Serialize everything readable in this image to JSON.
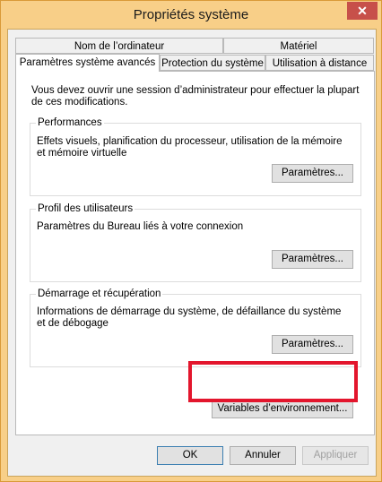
{
  "window": {
    "title": "Propriétés système",
    "close_symbol": "✕"
  },
  "tabs": {
    "row1": [
      "Nom de l’ordinateur",
      "Matériel"
    ],
    "row2": [
      "Paramètres système avancés",
      "Protection du système",
      "Utilisation à distance"
    ]
  },
  "panel": {
    "intro": "Vous devez ouvrir une session d’administrateur pour effectuer la plupart de ces modifications.",
    "performance": {
      "title": "Performances",
      "description": "Effets visuels, planification du processeur, utilisation de la mémoire et mémoire virtuelle",
      "button": "Paramètres..."
    },
    "profiles": {
      "title": "Profil des utilisateurs",
      "description": "Paramètres du Bureau liés à votre connexion",
      "button": "Paramètres..."
    },
    "startup": {
      "title": "Démarrage et récupération",
      "description": "Informations de démarrage du système, de défaillance du système et de débogage",
      "button": "Paramètres..."
    },
    "env_button": "Variables d’environnement..."
  },
  "footer": {
    "ok": "OK",
    "cancel": "Annuler",
    "apply": "Appliquer"
  },
  "colors": {
    "highlight": "#e3162d",
    "frame": "#f8cf88",
    "close": "#c7504a"
  }
}
